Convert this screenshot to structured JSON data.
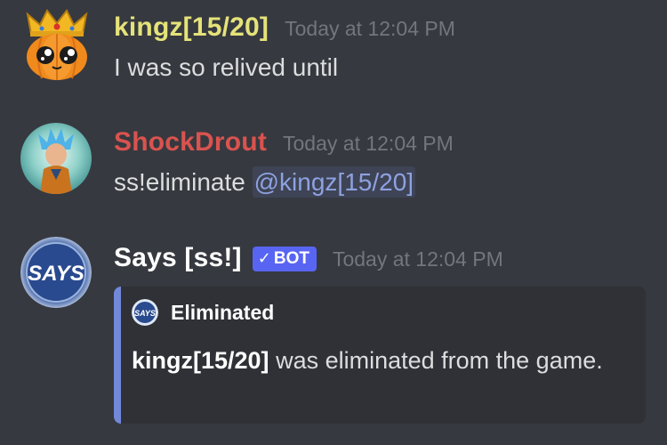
{
  "messages": [
    {
      "username": "kingz[15/20]",
      "username_color": "#e5e27a",
      "timestamp": "Today at 12:04 PM",
      "avatar_icon": "pumpkin-crown-avatar",
      "text": "I was so relived until"
    },
    {
      "username": "ShockDrout",
      "username_color": "#d9534f",
      "timestamp": "Today at 12:04 PM",
      "avatar_icon": "anime-character-avatar",
      "text": "ss!eliminate ",
      "mention": "@kingz[15/20]"
    },
    {
      "username": "Says [ss!]",
      "username_color": "#ffffff",
      "bot_tag": "BOT",
      "timestamp": "Today at 12:04 PM",
      "avatar_icon": "says-logo-avatar",
      "embed": {
        "accent_color": "#7289da",
        "author_icon": "says-logo-icon",
        "author_name": "Eliminated",
        "desc_bold": "kingz[15/20]",
        "desc_text": " was eliminated from the game."
      }
    }
  ],
  "logos": {
    "says_avatar_text": "SAYS",
    "says_icon_text": "SAYS"
  }
}
